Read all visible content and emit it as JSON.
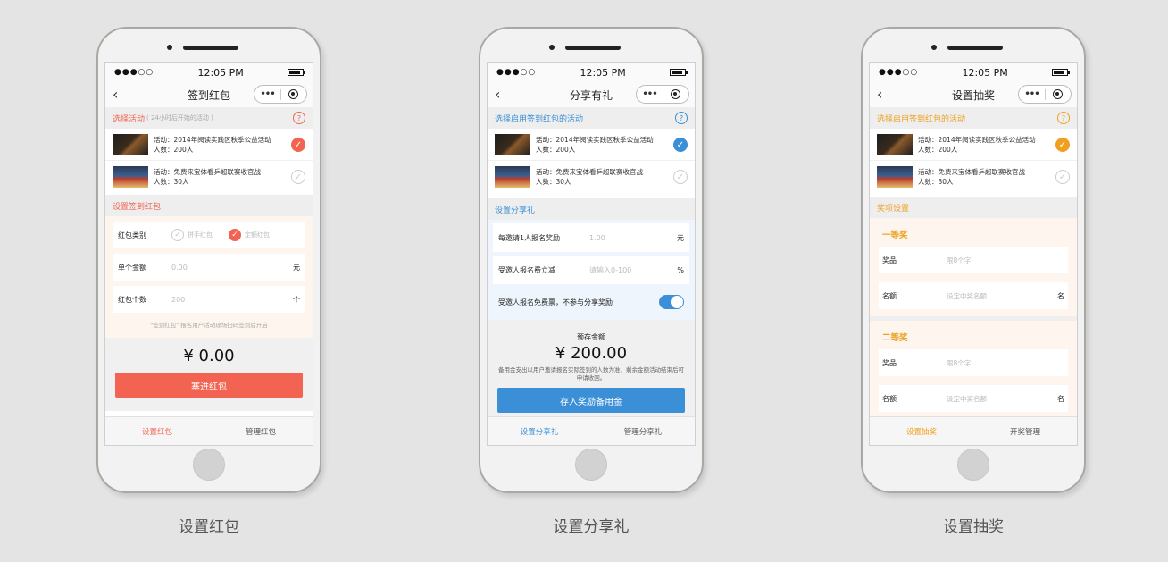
{
  "colors": {
    "red": "#f26451",
    "blue": "#3a8fd6",
    "orange": "#f0a020"
  },
  "status": {
    "signal": "●●●○○",
    "time": "12:05 PM"
  },
  "common": {
    "back_icon": "chevron-left-icon",
    "capsule_more": "•••"
  },
  "activities": [
    {
      "title": "活动：2014年阅读实践区秋季公益活动",
      "count": "人数：200人",
      "checked": true
    },
    {
      "title": "活动：免费来宝体看乒超联赛收官战",
      "count": "人数：30人",
      "checked": false
    }
  ],
  "phones": [
    {
      "title": "签到红包",
      "caption": "设置红包",
      "select_label": "选择活动",
      "select_hint": "( 24小时后开始的活动 )",
      "setup_label": "设置签到红包",
      "type_label": "红包类别",
      "type_options": [
        "拼手红包",
        "定额红包"
      ],
      "amount_label": "单个金额",
      "amount_placeholder": "0.00",
      "amount_unit": "元",
      "count_label": "红包个数",
      "count_placeholder": "200",
      "count_unit": "个",
      "note": "\"签到红包\" 报名用户活动现场扫码签到后开启",
      "total": "¥ 0.00",
      "button": "塞进红包",
      "tabs": [
        "设置红包",
        "管理红包"
      ]
    },
    {
      "title": "分享有礼",
      "caption": "设置分享礼",
      "select_label": "选择启用签到红包的活动",
      "setup_label": "设置分享礼",
      "reward_label": "每邀请1人报名奖励",
      "reward_placeholder": "1.00",
      "reward_unit": "元",
      "discount_label": "受邀人报名费立减",
      "discount_placeholder": "请输入0-100",
      "discount_unit": "%",
      "free_label": "受邀人报名免费票，不参与分享奖励",
      "deposit_label": "预存金额",
      "total": "¥ 200.00",
      "desc": "备用金支出以用户邀请报名实际签到的人数为准，剩余金额活动结束后可申请收回。",
      "button": "存入奖励备用金",
      "tabs": [
        "设置分享礼",
        "管理分享礼"
      ]
    },
    {
      "title": "设置抽奖",
      "caption": "设置抽奖",
      "select_label": "选择启用签到红包的活动",
      "setup_label": "奖项设置",
      "prizes": [
        {
          "name": "一等奖",
          "item_label": "奖品",
          "item_placeholder": "限8个字",
          "quota_label": "名额",
          "quota_placeholder": "设定中奖名额",
          "quota_unit": "名"
        },
        {
          "name": "二等奖",
          "item_label": "奖品",
          "item_placeholder": "限8个字",
          "quota_label": "名额",
          "quota_placeholder": "设定中奖名额",
          "quota_unit": "名"
        }
      ],
      "tabs": [
        "设置抽奖",
        "开奖管理"
      ]
    }
  ]
}
